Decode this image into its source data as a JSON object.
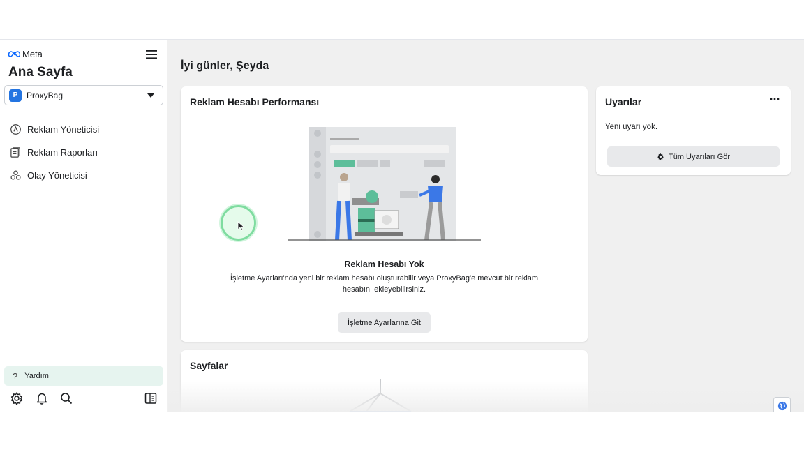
{
  "sidebar": {
    "brand": "Meta",
    "title": "Ana Sayfa",
    "account": {
      "badge": "P",
      "name": "ProxyBag"
    },
    "nav": [
      {
        "label": "Reklam Yöneticisi",
        "icon": "ads-manager-icon"
      },
      {
        "label": "Reklam Raporları",
        "icon": "ads-reporting-icon"
      },
      {
        "label": "Olay Yöneticisi",
        "icon": "events-manager-icon"
      }
    ],
    "help_label": "Yardım",
    "footer_icons": [
      "gear-icon",
      "bell-icon",
      "search-icon",
      "panel-toggle-icon"
    ]
  },
  "main": {
    "greeting": "İyi günler, Şeyda",
    "performance": {
      "title": "Reklam Hesabı Performansı",
      "empty_title": "Reklam Hesabı Yok",
      "empty_desc": "İşletme Ayarları'nda yeni bir reklam hesabı oluşturabilir veya ProxyBag'e mevcut bir reklam hesabını ekleyebilirsiniz.",
      "button": "İşletme Ayarlarına Git"
    },
    "alerts": {
      "title": "Uyarılar",
      "empty": "Yeni uyarı yok.",
      "button": "Tüm Uyarıları Gör"
    },
    "pages": {
      "title": "Sayfalar"
    }
  },
  "colors": {
    "accent": "#2374e1",
    "help_bg": "#e6f4ef",
    "cursor_ring": "#7fdca0"
  }
}
